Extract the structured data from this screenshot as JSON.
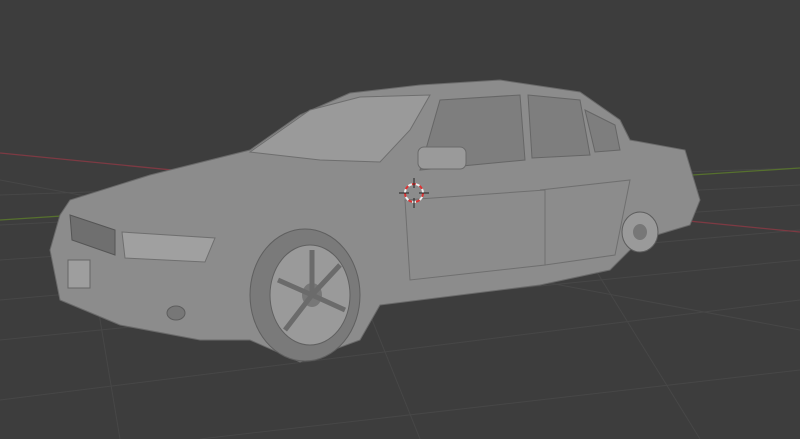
{
  "viewport": {
    "mode": "3d-viewport",
    "background_color": "#3d3d3d",
    "grid_color": "#4a4a4a",
    "x_axis_color": "#8a3b44",
    "y_axis_color": "#5b7a2e",
    "model_color": "#8f8f8f"
  },
  "cursor": {
    "icon": "3d-cursor-icon"
  },
  "model": {
    "name_icon": "car-model"
  }
}
